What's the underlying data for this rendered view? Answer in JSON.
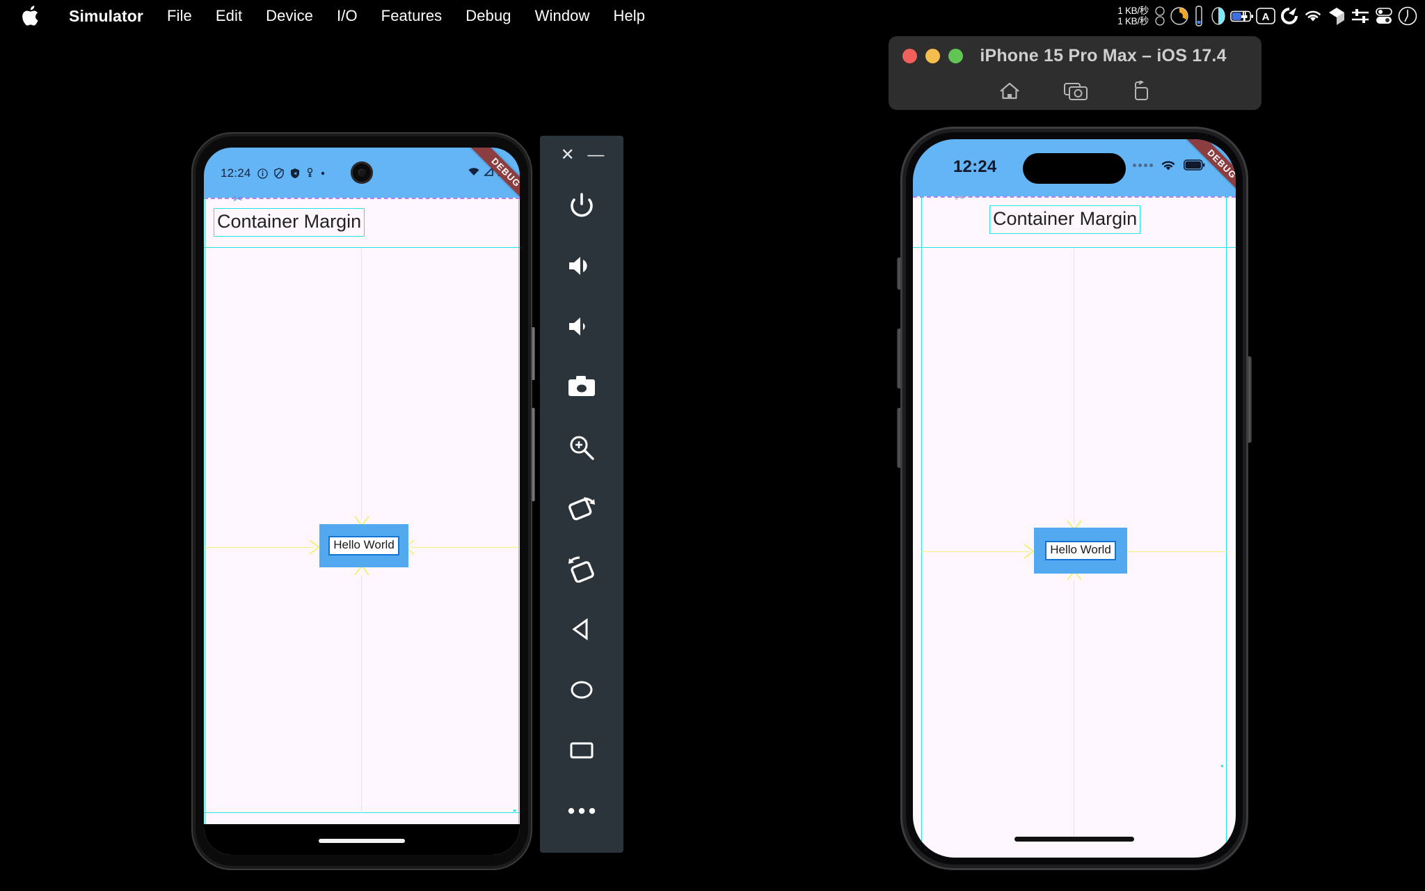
{
  "menubar": {
    "apple_icon": "apple-logo-icon",
    "items": [
      {
        "label": "Simulator",
        "bold": true
      },
      {
        "label": "File",
        "bold": false
      },
      {
        "label": "Edit",
        "bold": false
      },
      {
        "label": "Device",
        "bold": false
      },
      {
        "label": "I/O",
        "bold": false
      },
      {
        "label": "Features",
        "bold": false
      },
      {
        "label": "Debug",
        "bold": false
      },
      {
        "label": "Window",
        "bold": false
      },
      {
        "label": "Help",
        "bold": false
      }
    ],
    "status": {
      "net_down": "1 KB/秒",
      "net_up": "1 KB/秒",
      "icons": [
        "two-circles-icon",
        "cpu-gauge-icon",
        "memory-bar-icon",
        "disk-gauge-icon",
        "battery-charging-icon",
        "input-source-a-icon",
        "quick-record-icon",
        "wifi-icon",
        "dropbox-icon",
        "sliders-icon",
        "control-center-icon",
        "clock-icon"
      ]
    }
  },
  "simulator_window": {
    "title": "iPhone 15 Pro Max – iOS 17.4",
    "traffic_lights": [
      "close",
      "minimize",
      "zoom"
    ],
    "toolbar_icons": [
      "home-icon",
      "screenshot-icon",
      "rotate-icon"
    ],
    "colors": {
      "red": "#f1605a",
      "yellow": "#f5bd4f",
      "green": "#61c554"
    }
  },
  "android": {
    "status": {
      "time": "12:24",
      "left_icons": [
        "info-circle-icon",
        "shield-outline-icon",
        "shield-filled-icon",
        "key-icon",
        "dot-icon"
      ],
      "right_icons": [
        "wifi-icon",
        "signal-icon",
        "battery-icon"
      ]
    },
    "debug_banner": "DEBUG",
    "container_margin_label": "Container Margin",
    "hello_label": "Hello World",
    "scissors_icon": "scissors-overflow-icon"
  },
  "ios": {
    "status": {
      "time": "12:24",
      "right_icons": [
        "cellular-dots-icon",
        "wifi-icon",
        "battery-icon"
      ]
    },
    "debug_banner": "DEBUG",
    "container_margin_label": "Container Margin",
    "hello_label": "Hello World",
    "scissors_icon": "scissors-overflow-icon"
  },
  "emulator_toolbar": {
    "window_buttons": [
      {
        "label": "✕",
        "name": "close"
      },
      {
        "label": "—",
        "name": "minimize"
      }
    ],
    "buttons": [
      "power-icon",
      "volume-up-icon",
      "volume-down-icon",
      "screenshot-camera-icon",
      "zoom-in-icon",
      "rotate-left-icon",
      "rotate-right-icon",
      "back-icon",
      "home-icon",
      "overview-icon",
      "more-icon"
    ]
  },
  "colors": {
    "appbar_blue": "#64b5f6",
    "debug_guide_cyan": "#25e5e5",
    "debug_guide_purple": "#b77ef0",
    "debug_guide_yellow": "#f2ef7a",
    "hello_box_blue": "#52a9f0",
    "body_bg": "#fdf7fd",
    "ribbon_red": "#8b3d3f"
  }
}
